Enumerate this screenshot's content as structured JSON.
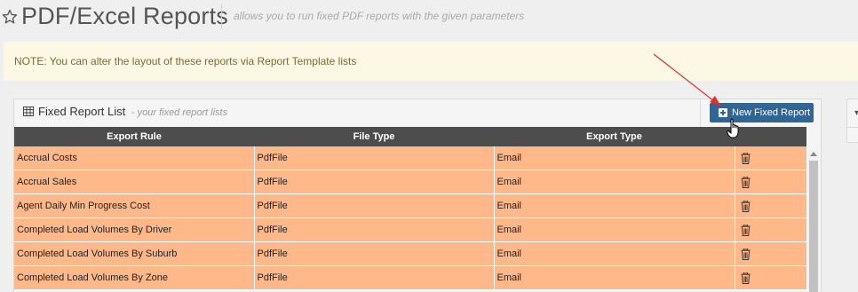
{
  "header": {
    "title": "PDF/Excel Reports",
    "subtitle": "allows you to run fixed PDF reports with the given parameters"
  },
  "note": {
    "text": "NOTE: You can alter the layout of these reports via Report Template lists"
  },
  "panel": {
    "title": "Fixed Report List",
    "subtitle": "- your fixed report lists",
    "new_button_label": "New Fixed Report"
  },
  "table": {
    "columns": [
      "Export Rule",
      "File Type",
      "Export Type",
      ""
    ],
    "rows": [
      [
        "Accrual Costs",
        "PdfFile",
        "Email"
      ],
      [
        "Accrual Sales",
        "PdfFile",
        "Email"
      ],
      [
        "Agent Daily Min Progress Cost",
        "PdfFile",
        "Email"
      ],
      [
        "Completed Load Volumes By Driver",
        "PdfFile",
        "Email"
      ],
      [
        "Completed Load Volumes By Suburb",
        "PdfFile",
        "Email"
      ],
      [
        "Completed Load Volumes By Zone",
        "PdfFile",
        "Email"
      ]
    ]
  },
  "colors": {
    "row_bg": "#ffb88a",
    "header_bg": "#4d4d4d",
    "button_bg": "#2f6696",
    "note_bg": "#fcf8e3",
    "annotation_arrow": "#e0302a"
  },
  "icons": {
    "title": "star-outline-icon",
    "panel": "table-grid-icon",
    "button": "plus-square-icon",
    "row_action": "trash-icon",
    "pointer": "hand-cursor-icon"
  }
}
